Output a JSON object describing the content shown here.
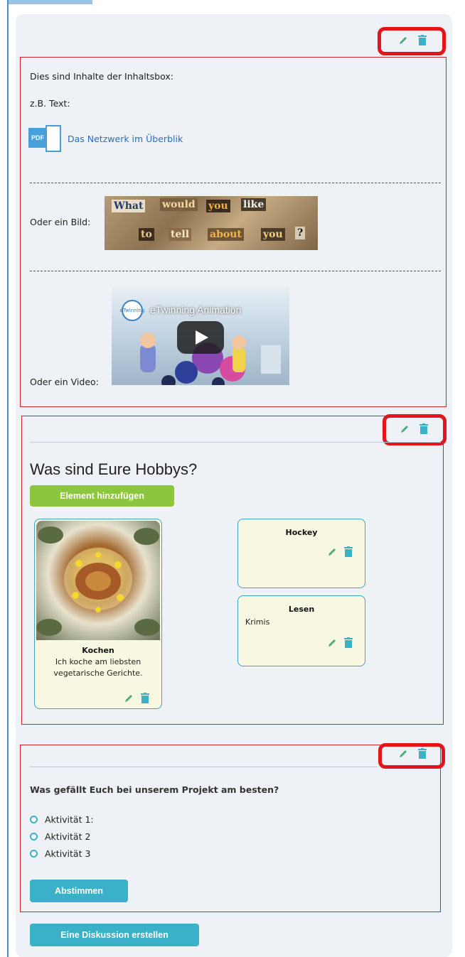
{
  "colors": {
    "accent_teal": "#3bb0c9",
    "accent_green": "#8cc63f",
    "highlight_red": "#e3151b",
    "link_blue": "#2a6fb8"
  },
  "content_box": {
    "intro": "Dies sind Inhalte der Inhaltsbox:",
    "text_example": "z.B. Text:",
    "pdf_badge": "PDF",
    "pdf_link": "Das Netzwerk im Überblik",
    "image_label": "Oder ein Bild:",
    "collage_words": [
      "What",
      "would",
      "you",
      "like",
      "to",
      "tell",
      "about",
      "you",
      "?"
    ],
    "video_label": "Oder ein Video:",
    "video_title": "eTwinning Animation",
    "video_logo": "eTwinning"
  },
  "hobbies": {
    "title": "Was sind Eure Hobbys?",
    "add_button": "Element hinzufügen",
    "cards": [
      {
        "title": "Kochen",
        "text_line1": "Ich koche am liebsten",
        "text_line2": "vegetarische Gerichte."
      },
      {
        "title": "Hockey",
        "text": ""
      },
      {
        "title": "Lesen",
        "text": "Krimis"
      }
    ]
  },
  "poll": {
    "question": "Was gefällt Euch bei unserem Projekt am besten?",
    "options": [
      "Aktivität 1:",
      "Aktivität 2",
      "Aktivität 3"
    ],
    "vote_button": "Abstimmen"
  },
  "discussion_button": "Eine Diskussion erstellen",
  "icons": {
    "edit": "pencil-icon",
    "delete": "trash-icon",
    "play": "play-icon",
    "pdf": "pdf-icon"
  }
}
